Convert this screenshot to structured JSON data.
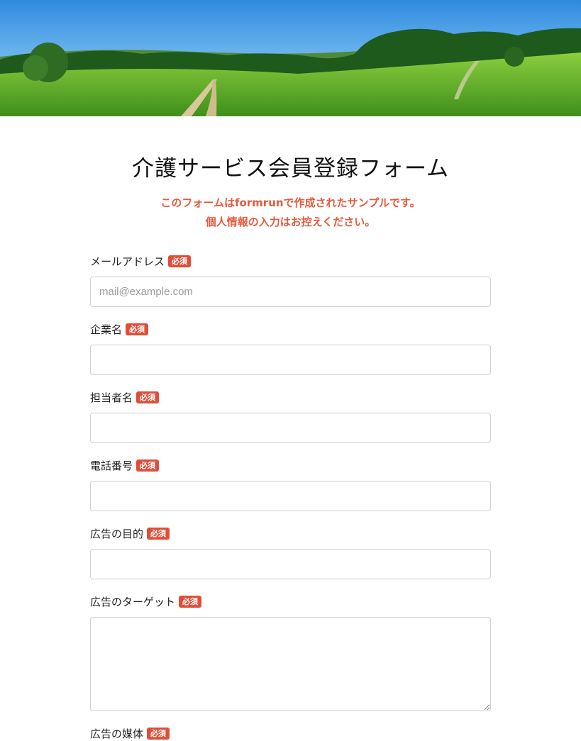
{
  "hero": {
    "image_alt": "green meadow landscape"
  },
  "form": {
    "title": "介護サービス会員登録フォーム",
    "notice_line1": "このフォームはformrunで作成されたサンプルです。",
    "notice_line2": "個人情報の入力はお控えください。",
    "required_label": "必須",
    "fields": [
      {
        "label": "メールアドレス",
        "placeholder": "mail@example.com",
        "value": ""
      },
      {
        "label": "企業名",
        "placeholder": "",
        "value": ""
      },
      {
        "label": "担当者名",
        "placeholder": "",
        "value": ""
      },
      {
        "label": "電話番号",
        "placeholder": "",
        "value": ""
      },
      {
        "label": "広告の目的",
        "placeholder": "",
        "value": ""
      },
      {
        "label": "広告のターゲット",
        "placeholder": "",
        "value": ""
      },
      {
        "label": "広告の媒体"
      }
    ]
  },
  "colors": {
    "accent": "#e04e3a",
    "notice": "#e55a3c",
    "border": "#cfcfcf"
  }
}
